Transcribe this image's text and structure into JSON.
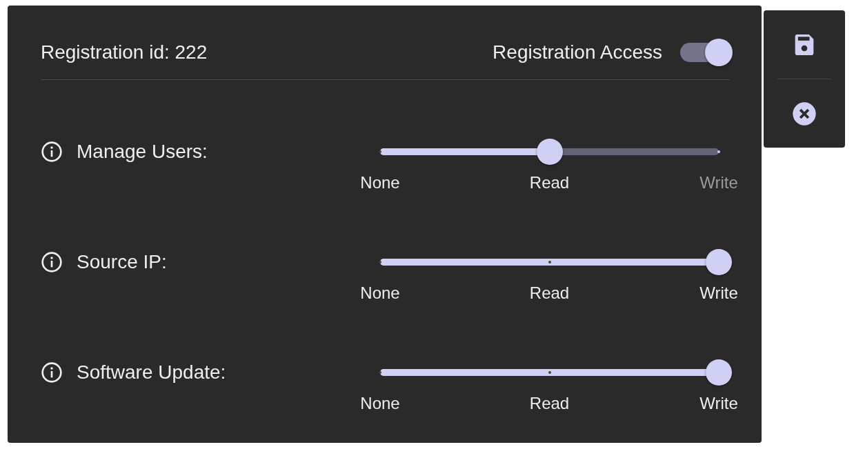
{
  "header": {
    "title": "Registration id: 222",
    "access": {
      "label": "Registration Access",
      "on": true
    }
  },
  "permissions": [
    {
      "label": "Manage Users:",
      "level": 0.5,
      "ticks": [
        {
          "label": "None",
          "active": true
        },
        {
          "label": "Read",
          "active": true
        },
        {
          "label": "Write",
          "active": false
        }
      ]
    },
    {
      "label": "Source IP:",
      "level": 1,
      "ticks": [
        {
          "label": "None",
          "active": true
        },
        {
          "label": "Read",
          "active": true
        },
        {
          "label": "Write",
          "active": true
        }
      ]
    },
    {
      "label": "Software Update:",
      "level": 1,
      "ticks": [
        {
          "label": "None",
          "active": true
        },
        {
          "label": "Read",
          "active": true
        },
        {
          "label": "Write",
          "active": true
        }
      ]
    }
  ],
  "actions": [
    {
      "kind": "save"
    },
    {
      "kind": "cancel"
    }
  ]
}
